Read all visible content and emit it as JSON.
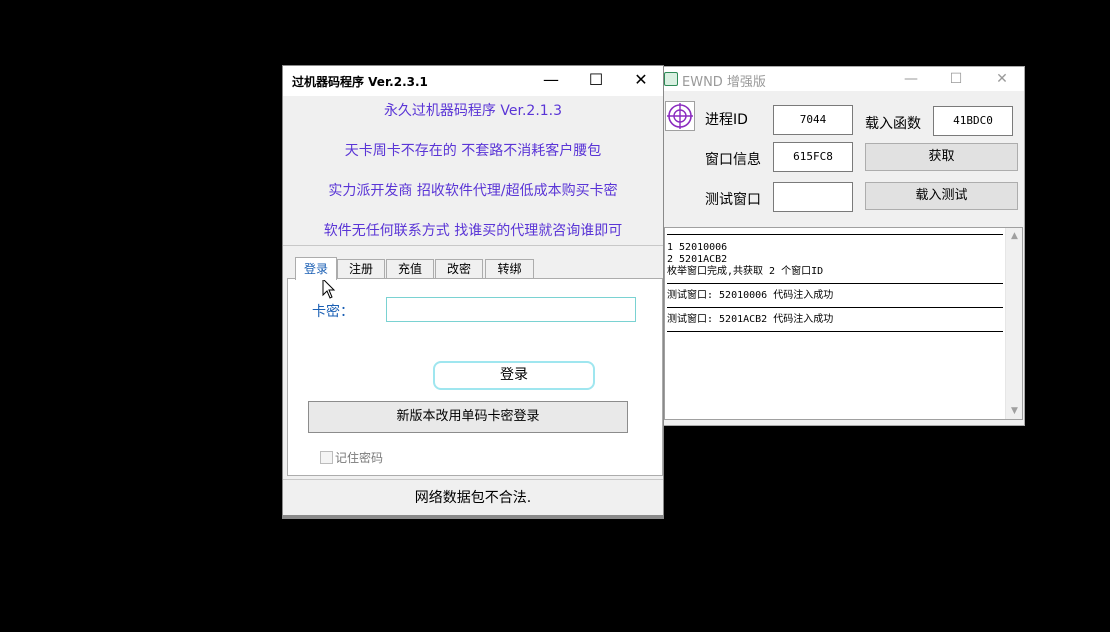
{
  "ewnd": {
    "title": "EWND 增强版",
    "window_controls": {
      "minimize": "—",
      "maximize": "☐",
      "close": "✕"
    },
    "process_id_label": "进程ID",
    "process_id_value": "7044",
    "load_func_label": "载入函数",
    "load_func_value": "41BDC0",
    "window_info_label": "窗口信息",
    "window_info_value": "615FC8",
    "get_button": "获取",
    "test_window_label": "测试窗口",
    "test_window_value": "",
    "load_test_button": "载入测试",
    "log": [
      [
        "1 52010006",
        "2 5201ACB2",
        "枚举窗口完成,共获取 2 个窗口ID"
      ],
      [
        "测试窗口: 52010006 代码注入成功"
      ],
      [
        "测试窗口: 5201ACB2 代码注入成功"
      ]
    ],
    "scroll_up": "▲",
    "scroll_down": "▼"
  },
  "main": {
    "title": "过机器码程序   Ver.2.3.1",
    "window_controls": {
      "minimize": "—",
      "maximize": "☐",
      "close": "✕"
    },
    "banner": [
      "永久过机器码程序 Ver.2.1.3",
      "天卡周卡不存在的 不套路不消耗客户腰包",
      "实力派开发商 招收软件代理/超低成本购买卡密",
      "软件无任何联系方式 找谁买的代理就咨询谁即可"
    ],
    "tabs": [
      "登录",
      "注册",
      "充值",
      "改密",
      "转绑"
    ],
    "active_tab": "登录",
    "card_label": "卡密：",
    "card_value": "",
    "login_button": "登录",
    "new_version_button": "新版本改用单码卡密登录",
    "remember_label": "记住密码",
    "remember_checked": false,
    "status": "网络数据包不合法."
  },
  "colors": {
    "banner_text": "#5a35d6",
    "accent_blue": "#1a5fb4",
    "input_border": "#7ad2d2",
    "login_border": "#9fe6ef",
    "background": "#000000"
  }
}
